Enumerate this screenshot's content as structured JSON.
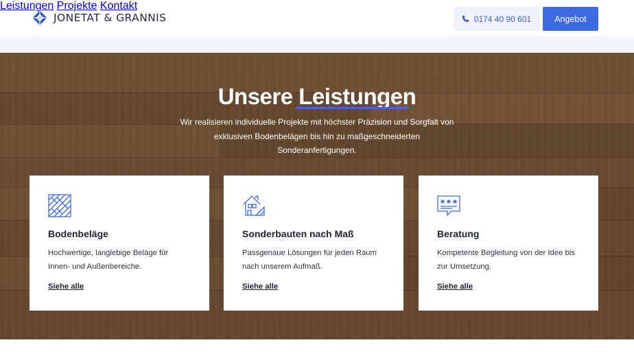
{
  "brand": {
    "name": "JONETAT & GRANNIS",
    "accent": "#3d6ae0"
  },
  "nav": {
    "items": [
      {
        "label": "Leistungen"
      },
      {
        "label": "Projekte"
      },
      {
        "label": "Kontakt"
      }
    ],
    "phone_label": "0174 40 90 601",
    "cta_label": "Angebot"
  },
  "hero": {
    "title": "Unsere Leistungen",
    "subtitle_line1": "Wir realisieren individuelle Projekte mit höchster Präzision und Sorgfalt von",
    "subtitle_line2": "exklusiven Bodenbelägen bis hin zu maßgeschneiderten",
    "subtitle_line3": "Sonderanfertigungen."
  },
  "services": [
    {
      "icon": "parquet-floor-icon",
      "title": "Bodenbeläge",
      "text_line1": "Hochwertige, langlebige Beläge für",
      "text_line2": "Innen- und Außenbereiche.",
      "link": "Siehe alle"
    },
    {
      "icon": "house-blueprint-icon",
      "title": "Sonderbauten nach Maß",
      "text_line1": "Passgenaue Lösungen für jeden Raum",
      "text_line2": "nach unserem Aufmaß.",
      "link": "Siehe alle"
    },
    {
      "icon": "review-chat-icon",
      "title": "Beratung",
      "text_line1": "Kompetente Begleitung von der Idee bis",
      "text_line2": "zur Umsetzung.",
      "link": "Siehe alle"
    }
  ]
}
